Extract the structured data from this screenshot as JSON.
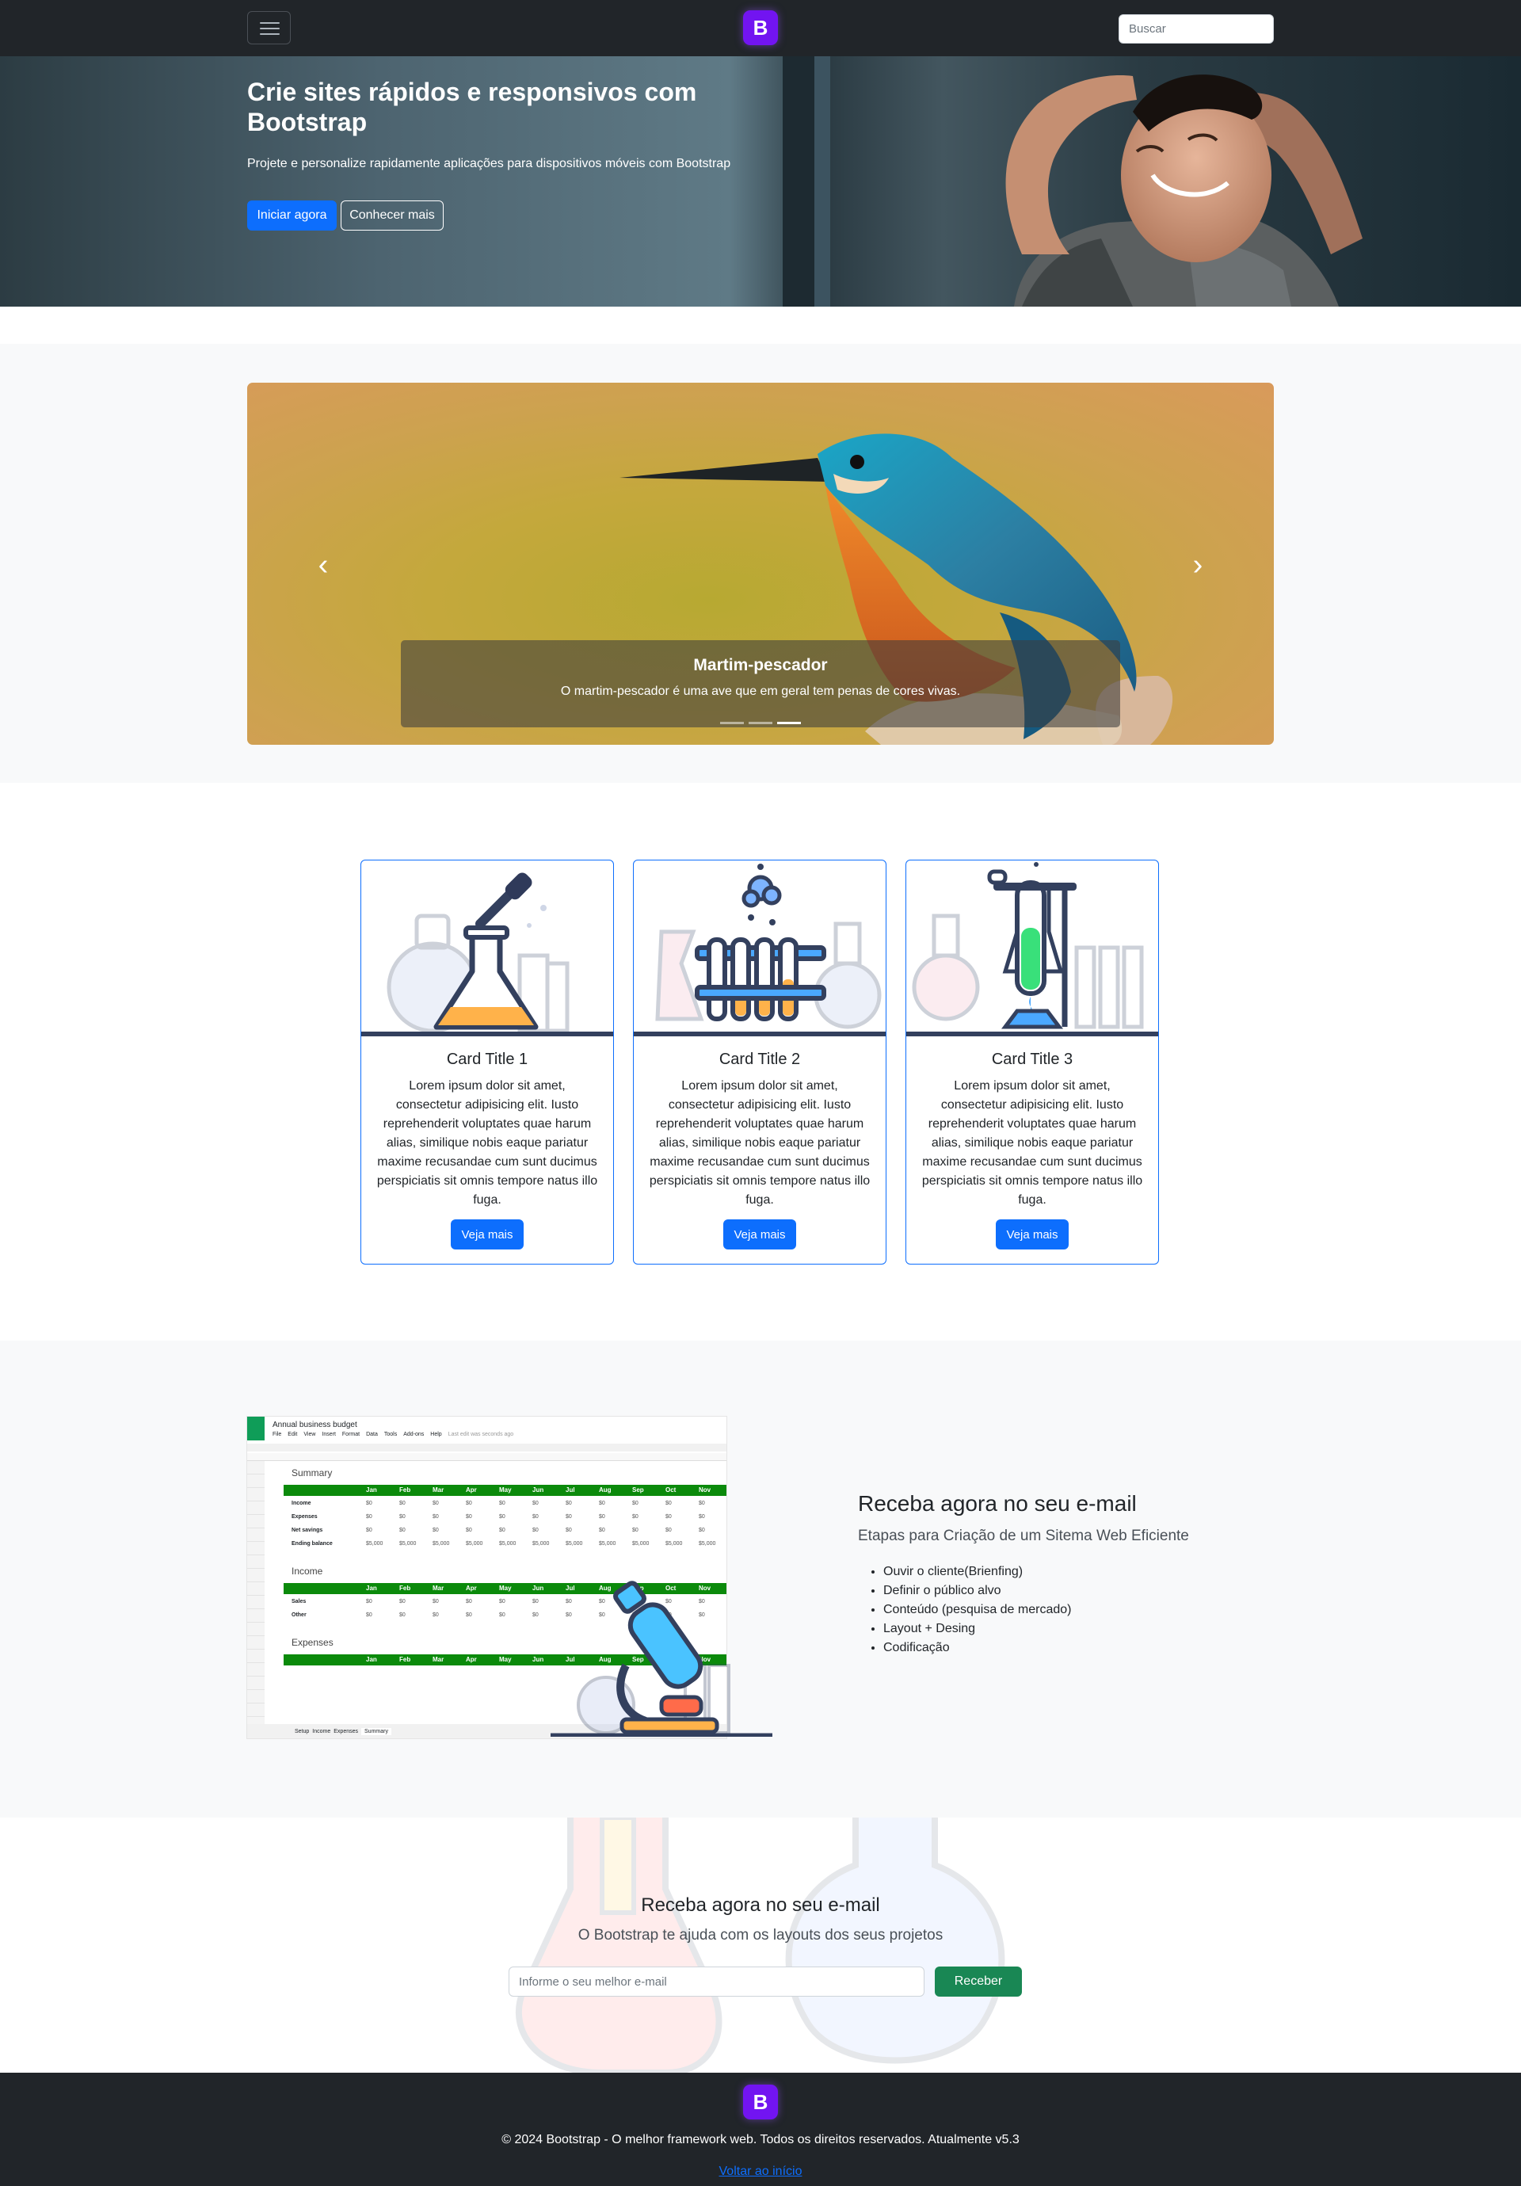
{
  "navbar": {
    "brand_letter": "B",
    "search_placeholder": "Buscar"
  },
  "hero": {
    "title": "Crie sites rápidos e responsivos com Bootstrap",
    "subtitle": "Projete e personalize rapidamente aplicações para dispositivos móveis com Bootstrap",
    "primary_button": "Iniciar agora",
    "secondary_button": "Conhecer mais"
  },
  "carousel": {
    "prev_icon": "‹",
    "next_icon": "›",
    "caption_title": "Martim-pescador",
    "caption_text": "O martim-pescador é uma ave que em geral tem penas de cores vivas.",
    "active_index": 2,
    "slide_count": 3
  },
  "cards": [
    {
      "title": "Card Title 1",
      "text": "Lorem ipsum dolor sit amet, consectetur adipisicing elit. Iusto reprehenderit voluptates quae harum alias, similique nobis eaque pariatur maxime recusandae cum sunt ducimus perspiciatis sit omnis tempore natus illo fuga.",
      "button": "Veja mais",
      "icon": "flask-dropper-icon"
    },
    {
      "title": "Card Title 2",
      "text": "Lorem ipsum dolor sit amet, consectetur adipisicing elit. Iusto reprehenderit voluptates quae harum alias, similique nobis eaque pariatur maxime recusandae cum sunt ducimus perspiciatis sit omnis tempore natus illo fuga.",
      "button": "Veja mais",
      "icon": "test-tubes-icon"
    },
    {
      "title": "Card Title 3",
      "text": "Lorem ipsum dolor sit amet, consectetur adipisicing elit. Iusto reprehenderit voluptates quae harum alias, similique nobis eaque pariatur maxime recusandae cum sunt ducimus perspiciatis sit omnis tempore natus illo fuga.",
      "button": "Veja mais",
      "icon": "burner-tube-icon"
    }
  ],
  "spreadsheet": {
    "title": "Annual business budget",
    "menu": [
      "File",
      "Edit",
      "View",
      "Insert",
      "Format",
      "Data",
      "Tools",
      "Add-ons",
      "Help"
    ],
    "last_edit": "Last edit was seconds ago",
    "months": [
      "Jan",
      "Feb",
      "Mar",
      "Apr",
      "May",
      "Jun",
      "Jul",
      "Aug",
      "Sep",
      "Oct",
      "Nov"
    ],
    "sections": [
      {
        "name": "Summary",
        "rows": [
          "Income",
          "Expenses",
          "Net savings",
          "Ending balance"
        ]
      },
      {
        "name": "Income",
        "rows": [
          "Sales",
          "Other"
        ]
      },
      {
        "name": "Expenses",
        "rows": []
      }
    ],
    "tabs": [
      "Setup",
      "Income",
      "Expenses",
      "Summary"
    ],
    "zero_value": "$0",
    "balance_value": "$5,000"
  },
  "feature": {
    "title": "Receba agora no seu e-mail",
    "lead": "Etapas para Criação de um Sitema Web Eficiente",
    "items": [
      "Ouvir o cliente(Brienfing)",
      "Definir o público alvo",
      "Conteúdo (pesquisa de mercado)",
      "Layout + Desing",
      "Codificação"
    ]
  },
  "subscribe": {
    "title": "Receba agora no seu e-mail",
    "lead": "O Bootstrap te ajuda com os layouts dos seus projetos",
    "placeholder": "Informe o seu melhor e-mail",
    "button": "Receber"
  },
  "footer": {
    "brand_letter": "B",
    "copyright": "© 2024 Bootstrap - O melhor framework web. Todos os direitos reservados. Atualmente v5.3",
    "back_link": "Voltar ao início"
  },
  "colors": {
    "dark": "#212529",
    "primary": "#0d6efd",
    "success": "#198754",
    "brand": "#7214f1",
    "light": "#f8f9fa"
  }
}
